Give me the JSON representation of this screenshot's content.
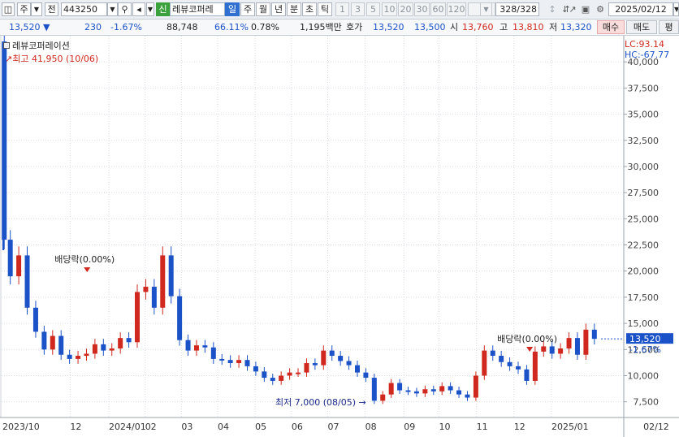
{
  "toolbar": {
    "period_type": "주",
    "prefix_label": "전",
    "stock_code": "443250",
    "badge_new": "신",
    "stock_name": "레뷰코퍼레",
    "period_tabs": [
      "일",
      "주",
      "월",
      "년",
      "분",
      "초",
      "틱"
    ],
    "minute_intervals": [
      "1",
      "3",
      "5",
      "10",
      "20",
      "30",
      "60",
      "120"
    ],
    "bar_count": "328/328",
    "date": "2025/02/12"
  },
  "quote": {
    "price": "13,520",
    "change": "230",
    "change_pct": "-1.67%",
    "volume": "88,748",
    "ratio": "66.11%",
    "turnover": "0.78%",
    "amount": "1,195백만",
    "hoga_label": "호가",
    "ask": "13,520",
    "bid": "13,500",
    "open_label": "시",
    "open": "13,760",
    "high_label": "고",
    "high": "13,810",
    "low_label": "저",
    "low": "13,320",
    "buy_label": "매수",
    "sell_label": "매도",
    "eval_label": "평"
  },
  "legend": {
    "name": "레뷰코퍼레이션",
    "high_label": "최고 41,950 (10/06)",
    "low_label": "최저 7,000 (08/05)",
    "lc": "LC:93.14",
    "hc": "HC:-67.77"
  },
  "colors": {
    "up": "#d0281e",
    "down": "#1c52c8",
    "grid": "#d9dde2",
    "current_box": "#1c52c8"
  },
  "chart_data": {
    "type": "candlestick",
    "ylim": [
      6000,
      42500
    ],
    "yticks": [
      "40,000",
      "37,500",
      "35,000",
      "32,500",
      "30,000",
      "27,500",
      "25,000",
      "22,500",
      "20,000",
      "17,500",
      "15,000",
      "12,500",
      "10,000",
      "7,500"
    ],
    "xlabels": [
      "2023/10",
      "12",
      "2024/01",
      "02",
      "03",
      "04",
      "05",
      "06",
      "07",
      "08",
      "09",
      "10",
      "11",
      "12",
      "2025/01",
      "02/12"
    ],
    "current_price": "13,520",
    "current_change": "-1.67%",
    "annotations": [
      {
        "text": "배당락(0.00%)",
        "date": "2023-12",
        "price": 20200
      },
      {
        "text": "배당락(0.00%)",
        "date": "2024-12",
        "price": 12600
      }
    ],
    "series": [
      {
        "values": [
          [
            "2023-10-06",
            41950
          ],
          [
            "2023-10-09",
            23000
          ],
          [
            "2023-10-16",
            19500
          ],
          [
            "2023-10-23",
            21500
          ],
          [
            "2023-10-30",
            16500
          ],
          [
            "2023-11-06",
            14200
          ],
          [
            "2023-11-13",
            12500
          ],
          [
            "2023-11-20",
            13800
          ],
          [
            "2023-11-27",
            12000
          ],
          [
            "2023-12-04",
            11600
          ],
          [
            "2023-12-11",
            11900
          ],
          [
            "2023-12-18",
            12100
          ],
          [
            "2023-12-25",
            13000
          ],
          [
            "2024-01-01",
            12400
          ],
          [
            "2024-01-08",
            12600
          ],
          [
            "2024-01-15",
            13600
          ],
          [
            "2024-01-22",
            13200
          ],
          [
            "2024-01-29",
            18000
          ],
          [
            "2024-02-05",
            18500
          ],
          [
            "2024-02-12",
            16500
          ],
          [
            "2024-02-19",
            21500
          ],
          [
            "2024-02-26",
            17600
          ],
          [
            "2024-03-04",
            13400
          ],
          [
            "2024-03-11",
            12400
          ],
          [
            "2024-03-18",
            12900
          ],
          [
            "2024-03-25",
            12700
          ],
          [
            "2024-04-01",
            11600
          ],
          [
            "2024-04-08",
            11500
          ],
          [
            "2024-04-15",
            11200
          ],
          [
            "2024-04-22",
            11500
          ],
          [
            "2024-04-29",
            10900
          ],
          [
            "2024-05-06",
            10400
          ],
          [
            "2024-05-13",
            9800
          ],
          [
            "2024-05-20",
            9500
          ],
          [
            "2024-05-27",
            10000
          ],
          [
            "2024-06-03",
            10300
          ],
          [
            "2024-06-10",
            10300
          ],
          [
            "2024-06-17",
            11200
          ],
          [
            "2024-06-24",
            11000
          ],
          [
            "2024-07-01",
            12400
          ],
          [
            "2024-07-08",
            11900
          ],
          [
            "2024-07-15",
            11400
          ],
          [
            "2024-07-22",
            11000
          ],
          [
            "2024-07-29",
            10300
          ],
          [
            "2024-08-05",
            9800
          ],
          [
            "2024-08-12",
            7600
          ],
          [
            "2024-08-19",
            8200
          ],
          [
            "2024-08-26",
            9300
          ],
          [
            "2024-09-02",
            8600
          ],
          [
            "2024-09-09",
            8500
          ],
          [
            "2024-09-16",
            8300
          ],
          [
            "2024-09-23",
            8700
          ],
          [
            "2024-09-30",
            8500
          ],
          [
            "2024-10-07",
            9000
          ],
          [
            "2024-10-14",
            8600
          ],
          [
            "2024-10-21",
            8200
          ],
          [
            "2024-10-28",
            7900
          ],
          [
            "2024-11-04",
            10000
          ],
          [
            "2024-11-11",
            12400
          ],
          [
            "2024-11-18",
            11900
          ],
          [
            "2024-11-25",
            11300
          ],
          [
            "2024-12-02",
            10900
          ],
          [
            "2024-12-09",
            10600
          ],
          [
            "2024-12-16",
            9500
          ],
          [
            "2024-12-23",
            12300
          ],
          [
            "2024-12-30",
            12800
          ],
          [
            "2025-01-06",
            12100
          ],
          [
            "2025-01-13",
            12600
          ],
          [
            "2025-01-20",
            13600
          ],
          [
            "2025-01-27",
            12000
          ],
          [
            "2025-02-03",
            14400
          ],
          [
            "2025-02-10",
            13520
          ]
        ]
      }
    ]
  }
}
